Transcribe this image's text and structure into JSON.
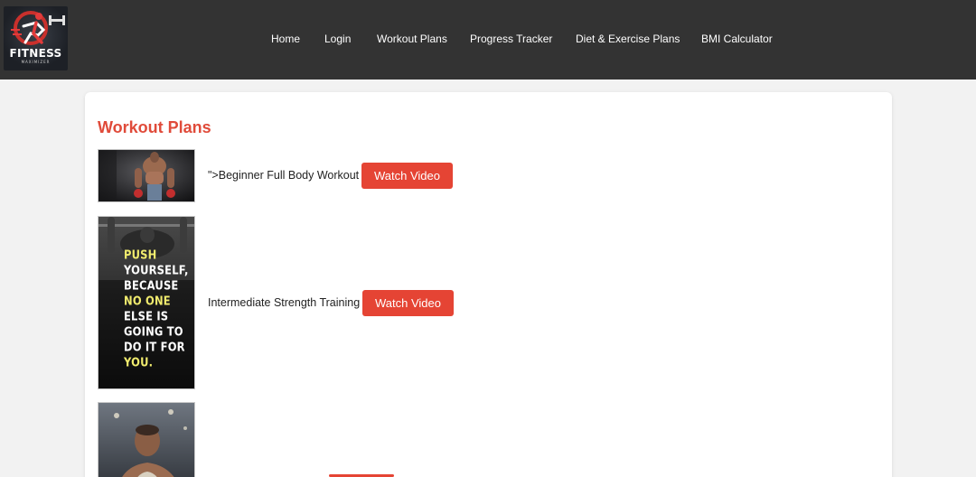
{
  "logo": {
    "title": "FITNESS",
    "subtitle": "MAXIMIZER"
  },
  "nav": {
    "items": [
      "Home",
      "Login",
      "Workout Plans",
      "Progress Tracker",
      "Diet & Exercise Plans",
      "BMI Calculator"
    ]
  },
  "main": {
    "title": "Workout Plans",
    "plans": [
      {
        "name": "\">Beginner Full Body Workout",
        "button": "Watch Video"
      },
      {
        "name": "Intermediate Strength Training",
        "button": "Watch Video"
      },
      {
        "name": "",
        "button": ""
      }
    ],
    "poster_lines": [
      "PUSH",
      "YOURSELF,",
      "BECAUSE",
      "NO ONE",
      "ELSE IS",
      "GOING TO",
      "DO IT FOR",
      "YOU."
    ]
  },
  "colors": {
    "header_bg": "#333333",
    "accent": "#e04b3a",
    "button_bg": "#e54434",
    "page_bg": "#f2f2f2",
    "poster_highlight": "#f1ec6e"
  },
  "icons": [
    "logo-runner-icon"
  ]
}
